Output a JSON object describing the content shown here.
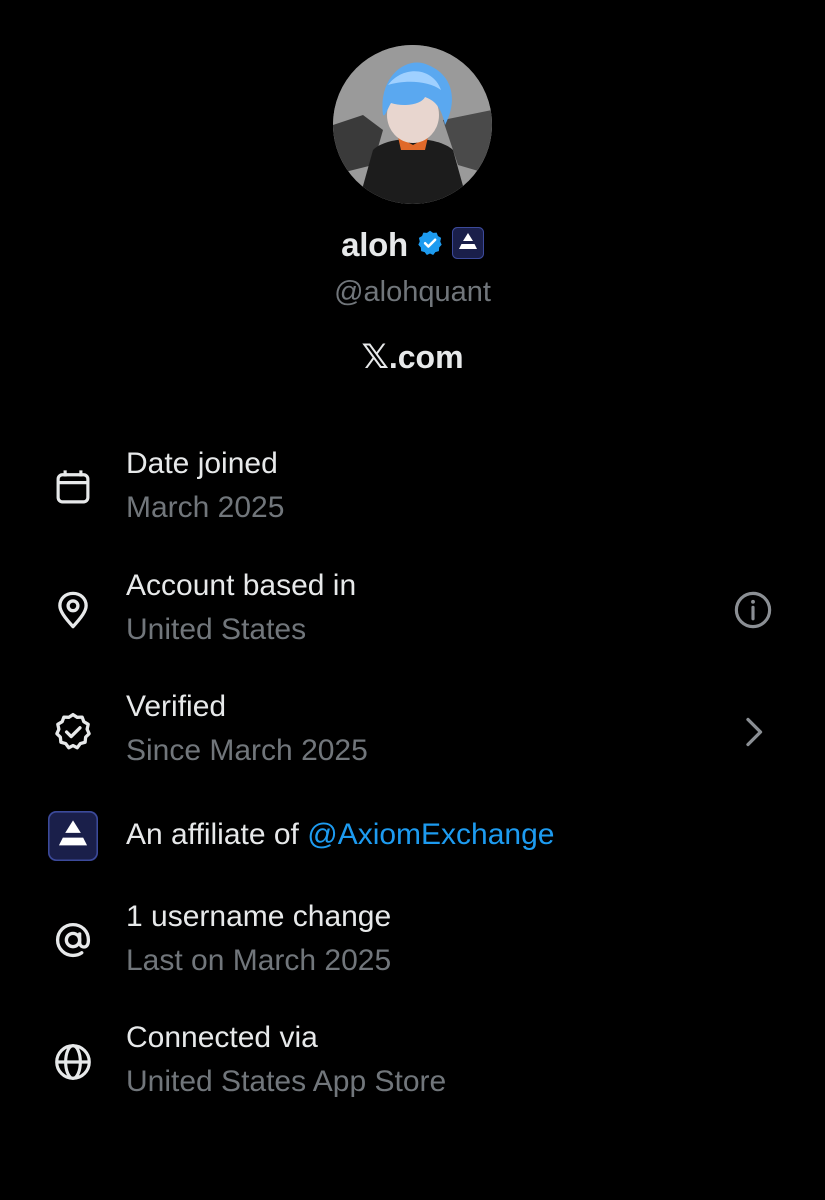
{
  "profile": {
    "display_name": "aloh",
    "handle": "@alohquant",
    "site": "X.com",
    "site_x_glyph": "𝕏",
    "site_suffix": ".com",
    "avatar_icon": "avatar-anime-character",
    "verified_icon": "verified-badge-icon",
    "affiliate_badge_icon": "axiom-logo-icon"
  },
  "rows": [
    {
      "icon": "calendar-icon",
      "title": "Date joined",
      "subtitle": "March 2025",
      "trailing": null
    },
    {
      "icon": "location-pin-icon",
      "title": "Account based in",
      "subtitle": "United States",
      "trailing": "info-icon"
    },
    {
      "icon": "verified-outline-icon",
      "title": "Verified",
      "subtitle": "Since March 2025",
      "trailing": "chevron-right-icon"
    },
    {
      "icon": "axiom-logo-icon",
      "title_prefix": "An affiliate of ",
      "title_link": "@AxiomExchange",
      "trailing": null
    },
    {
      "icon": "at-sign-icon",
      "title": "1 username change",
      "subtitle": "Last on March 2025",
      "trailing": null
    },
    {
      "icon": "globe-icon",
      "title": "Connected via",
      "subtitle": "United States App Store",
      "trailing": null
    }
  ],
  "colors": {
    "background": "#000000",
    "primary_text": "#e7e9ea",
    "secondary_text": "#71767b",
    "link": "#1d9bf0",
    "verified_badge": "#1d9bf0"
  }
}
